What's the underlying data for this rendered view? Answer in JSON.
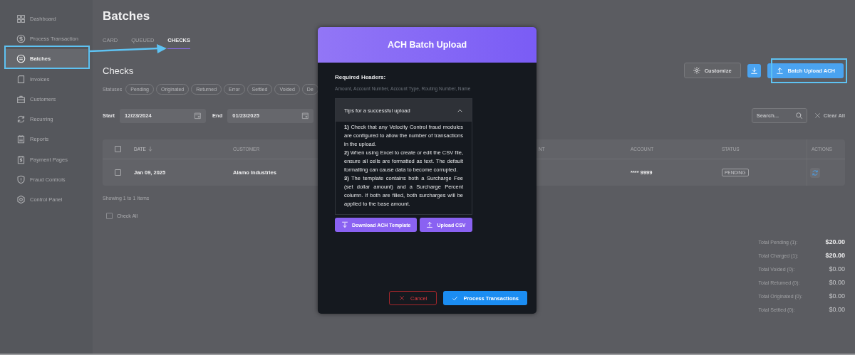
{
  "sidebar": {
    "items": [
      {
        "label": "Dashboard",
        "selected": false
      },
      {
        "label": "Process Transaction",
        "selected": false
      },
      {
        "label": "Batches",
        "selected": true
      },
      {
        "label": "Invoices",
        "selected": false
      },
      {
        "label": "Customers",
        "selected": false
      },
      {
        "label": "Recurring",
        "selected": false
      },
      {
        "label": "Reports",
        "selected": false
      },
      {
        "label": "Payment Pages",
        "selected": false
      },
      {
        "label": "Fraud Controls",
        "selected": false
      },
      {
        "label": "Control Panel",
        "selected": false
      }
    ]
  },
  "page_title": "Batches",
  "tabs": [
    {
      "label": "CARD",
      "selected": false
    },
    {
      "label": "QUEUED",
      "selected": false
    },
    {
      "label": "CHECKS",
      "selected": true
    }
  ],
  "section_title": "Checks",
  "toolbar": {
    "customize": "Customize",
    "batch_upload": "Batch Upload ACH"
  },
  "statuses": {
    "label": "Statuses",
    "chips": [
      "Pending",
      "Originated",
      "Returned",
      "Error",
      "Settled",
      "Voided",
      "De"
    ]
  },
  "date_range": {
    "start_label": "Start",
    "start": "12/23/2024",
    "end_label": "End",
    "end": "01/23/2025"
  },
  "search": {
    "placeholder": "Search..."
  },
  "clear_all": "Clear All",
  "table": {
    "header_checked": false,
    "columns": [
      {
        "label": "DATE",
        "sorted": true
      },
      {
        "label": "CUSTOMER",
        "sorted": false
      },
      {
        "label": "NT",
        "sorted": false
      },
      {
        "label": "ACCOUNT",
        "sorted": false
      },
      {
        "label": "STATUS",
        "sorted": false
      },
      {
        "label": "ACTIONS",
        "sorted": false
      }
    ],
    "rows": [
      {
        "checked": false,
        "date": "Jan 09, 2025",
        "customer": "Alamo Industries",
        "account": "**** 9999",
        "status": "PENDING"
      }
    ]
  },
  "showing": "Showing 1 to 1 Items",
  "check_all": {
    "label": "Check All",
    "checked": false
  },
  "totals": [
    {
      "label": "Total Pending (1):",
      "value": "$20.00",
      "highlighted": true
    },
    {
      "label": "Total Charged (1):",
      "value": "$20.00",
      "highlighted": true
    },
    {
      "label": "Total Voided (0):",
      "value": "$0.00",
      "highlighted": false
    },
    {
      "label": "Total Returned (0):",
      "value": "$0.00",
      "highlighted": false
    },
    {
      "label": "Total Originated (0):",
      "value": "$0.00",
      "highlighted": false
    },
    {
      "label": "Total Settled (0):",
      "value": "$0.00",
      "highlighted": false
    }
  ],
  "modal": {
    "title": "ACH Batch Upload",
    "required_label": "Required Headers:",
    "required_headers": "Amount, Account Number, Account Type, Routing Number, Name",
    "tips": {
      "title": "Tips for a successful upload",
      "expanded": true,
      "items": [
        "**1)** Check that any Velocity Control fraud modules are configured to allow the number of transactions in the upload.",
        "**2)** When using Excel to create or edit the CSV file, ensure all cells are formatted as text. The default formatting can cause data to become corrupted.",
        "**3)** The template contains both a Surcharge Fee (set dollar amount) and a Surcharge Percent column. If both are filled, both surcharges will be applied to the base amount."
      ]
    },
    "download_button": "Download ACH Template",
    "upload_button": "Upload CSV",
    "cancel_button": "Cancel",
    "process_button": "Process Transactions"
  }
}
